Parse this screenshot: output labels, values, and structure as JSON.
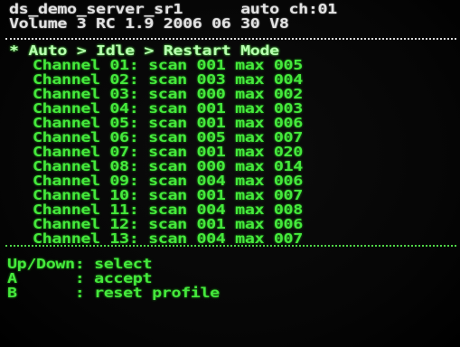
{
  "header": {
    "line1": "ds_demo_server_sr1      auto ch:01",
    "line2": "Volume 3 RC 1.9 2006 06 30 V8"
  },
  "menu": {
    "breadcrumb": "* Auto > Idle > Restart Mode"
  },
  "channels": [
    {
      "label": "Channel 01:",
      "scan": "scan 001",
      "max": "max 005"
    },
    {
      "label": "Channel 02:",
      "scan": "scan 003",
      "max": "max 004"
    },
    {
      "label": "Channel 03:",
      "scan": "scan 000",
      "max": "max 002"
    },
    {
      "label": "Channel 04:",
      "scan": "scan 001",
      "max": "max 003"
    },
    {
      "label": "Channel 05:",
      "scan": "scan 001",
      "max": "max 006"
    },
    {
      "label": "Channel 06:",
      "scan": "scan 005",
      "max": "max 007"
    },
    {
      "label": "Channel 07:",
      "scan": "scan 001",
      "max": "max 020"
    },
    {
      "label": "Channel 08:",
      "scan": "scan 000",
      "max": "max 014"
    },
    {
      "label": "Channel 09:",
      "scan": "scan 004",
      "max": "max 006"
    },
    {
      "label": "Channel 10:",
      "scan": "scan 001",
      "max": "max 007"
    },
    {
      "label": "Channel 11:",
      "scan": "scan 004",
      "max": "max 008"
    },
    {
      "label": "Channel 12:",
      "scan": "scan 001",
      "max": "max 006"
    },
    {
      "label": "Channel 13:",
      "scan": "scan 004",
      "max": "max 007"
    }
  ],
  "help": [
    {
      "key": "Up/Down:",
      "action": "select"
    },
    {
      "key": "A      :",
      "action": "accept"
    },
    {
      "key": "B      :",
      "action": "reset profile"
    }
  ],
  "colors": {
    "header": "#e2e2e2",
    "highlight": "#b8ffb0",
    "text": "#45e83c",
    "background": "#030303"
  }
}
